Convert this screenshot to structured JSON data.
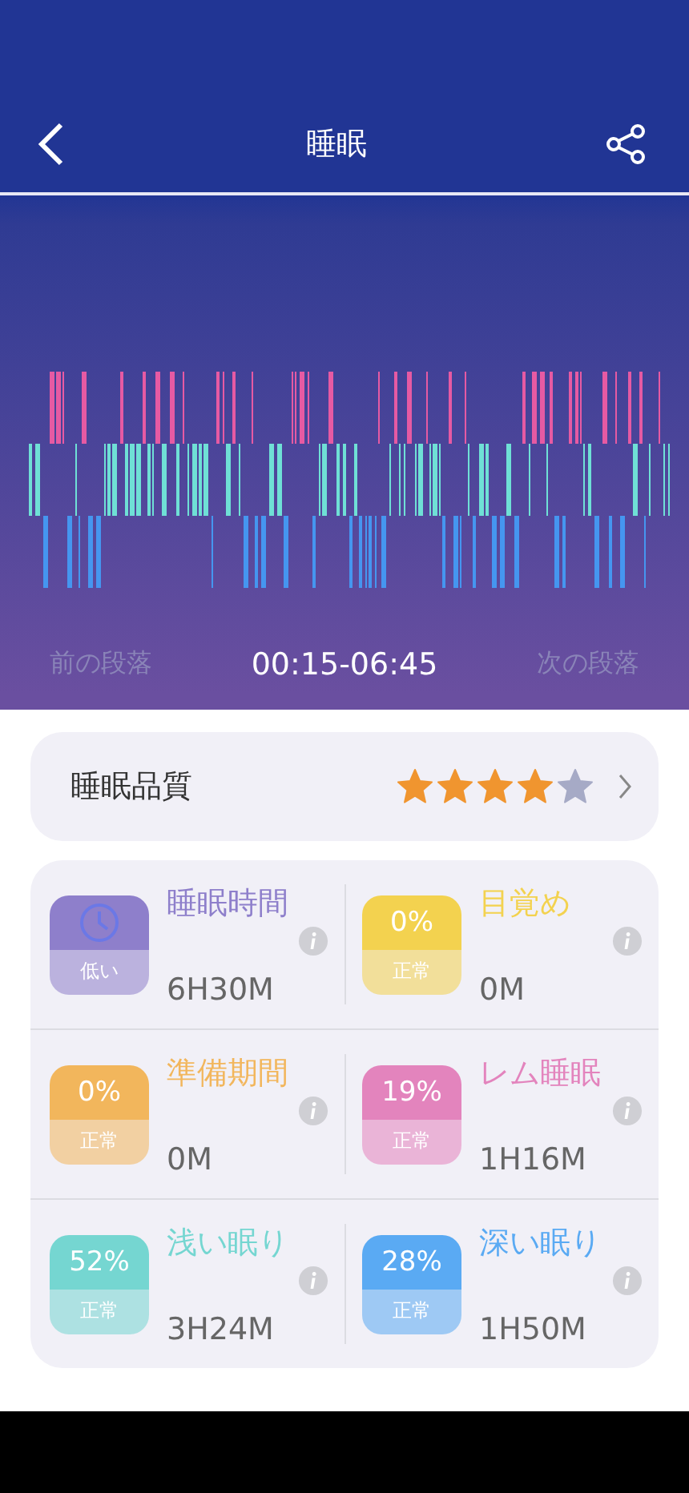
{
  "header": {
    "title": "睡眠"
  },
  "chart_nav": {
    "previous": "前の段落",
    "range": "00:15-06:45",
    "next": "次の段落"
  },
  "quality": {
    "label": "睡眠品質",
    "stars": 4
  },
  "metrics": [
    {
      "kind": "clock",
      "title": "睡眠時間",
      "status": "低い",
      "value": "6H30M",
      "color": "#8e7fcb"
    },
    {
      "kind": "percent",
      "percent": "0%",
      "title": "目覚め",
      "status": "正常",
      "value": "0M",
      "color": "#f3d24f"
    },
    {
      "kind": "percent",
      "percent": "0%",
      "title": "準備期間",
      "status": "正常",
      "value": "0M",
      "color": "#f2b65c"
    },
    {
      "kind": "percent",
      "percent": "19%",
      "title": "レム睡眠",
      "status": "正常",
      "value": "1H16M",
      "color": "#e384bd"
    },
    {
      "kind": "percent",
      "percent": "52%",
      "title": "浅い眠り",
      "status": "正常",
      "value": "3H24M",
      "color": "#75d6d1"
    },
    {
      "kind": "percent",
      "percent": "28%",
      "title": "深い眠り",
      "status": "正常",
      "value": "1H50M",
      "color": "#5aaaf3"
    }
  ]
}
